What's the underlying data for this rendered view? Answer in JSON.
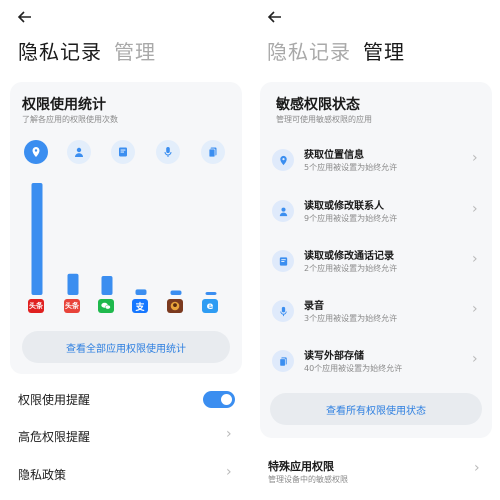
{
  "colors": {
    "accent": "#3b8ef0",
    "card_bg": "#f6f7f9",
    "button_text": "#2d7fe0"
  },
  "left": {
    "tabs": [
      {
        "label": "隐私记录",
        "active": true
      },
      {
        "label": "管理",
        "active": false
      }
    ],
    "stats_card": {
      "title": "权限使用统计",
      "subtitle": "了解各应用的权限使用次数",
      "categories": [
        "location-icon",
        "contacts-icon",
        "call-log-icon",
        "microphone-icon",
        "storage-icon"
      ],
      "apps": [
        {
          "icon": "toutiao-app-icon",
          "label": "头条"
        },
        {
          "icon": "toutiao-lite-app-icon",
          "label": "头条"
        },
        {
          "icon": "wechat-app-icon"
        },
        {
          "icon": "alipay-app-icon",
          "label": "支"
        },
        {
          "icon": "game-app-icon"
        },
        {
          "icon": "browser-app-icon",
          "label": "e"
        }
      ],
      "button": "查看全部应用权限使用统计"
    },
    "settings": [
      {
        "label": "权限使用提醒",
        "type": "toggle",
        "on": true
      },
      {
        "label": "高危权限提醒",
        "type": "chevron"
      },
      {
        "label": "隐私政策",
        "type": "chevron"
      }
    ]
  },
  "chart_data": {
    "type": "bar",
    "categories": [
      "头条",
      "头条",
      "微信",
      "支付宝",
      "游戏",
      "浏览器"
    ],
    "values": [
      100,
      19,
      17,
      5,
      4,
      1
    ]
  },
  "right": {
    "tabs": [
      {
        "label": "隐私记录",
        "active": false
      },
      {
        "label": "管理",
        "active": true
      }
    ],
    "perm_card": {
      "title": "敏感权限状态",
      "subtitle": "管理可使用敏感权限的应用",
      "items": [
        {
          "icon": "location-icon",
          "title": "获取位置信息",
          "sub": "5个应用被设置为始终允许"
        },
        {
          "icon": "contacts-icon",
          "title": "读取或修改联系人",
          "sub": "9个应用被设置为始终允许"
        },
        {
          "icon": "call-log-icon",
          "title": "读取或修改通话记录",
          "sub": "2个应用被设置为始终允许"
        },
        {
          "icon": "microphone-icon",
          "title": "录音",
          "sub": "3个应用被设置为始终允许"
        },
        {
          "icon": "storage-icon",
          "title": "读写外部存储",
          "sub": "40个应用被设置为始终允许"
        }
      ],
      "button": "查看所有权限使用状态"
    },
    "special": {
      "title": "特殊应用权限",
      "sub": "管理设备中的敏感权限"
    }
  }
}
